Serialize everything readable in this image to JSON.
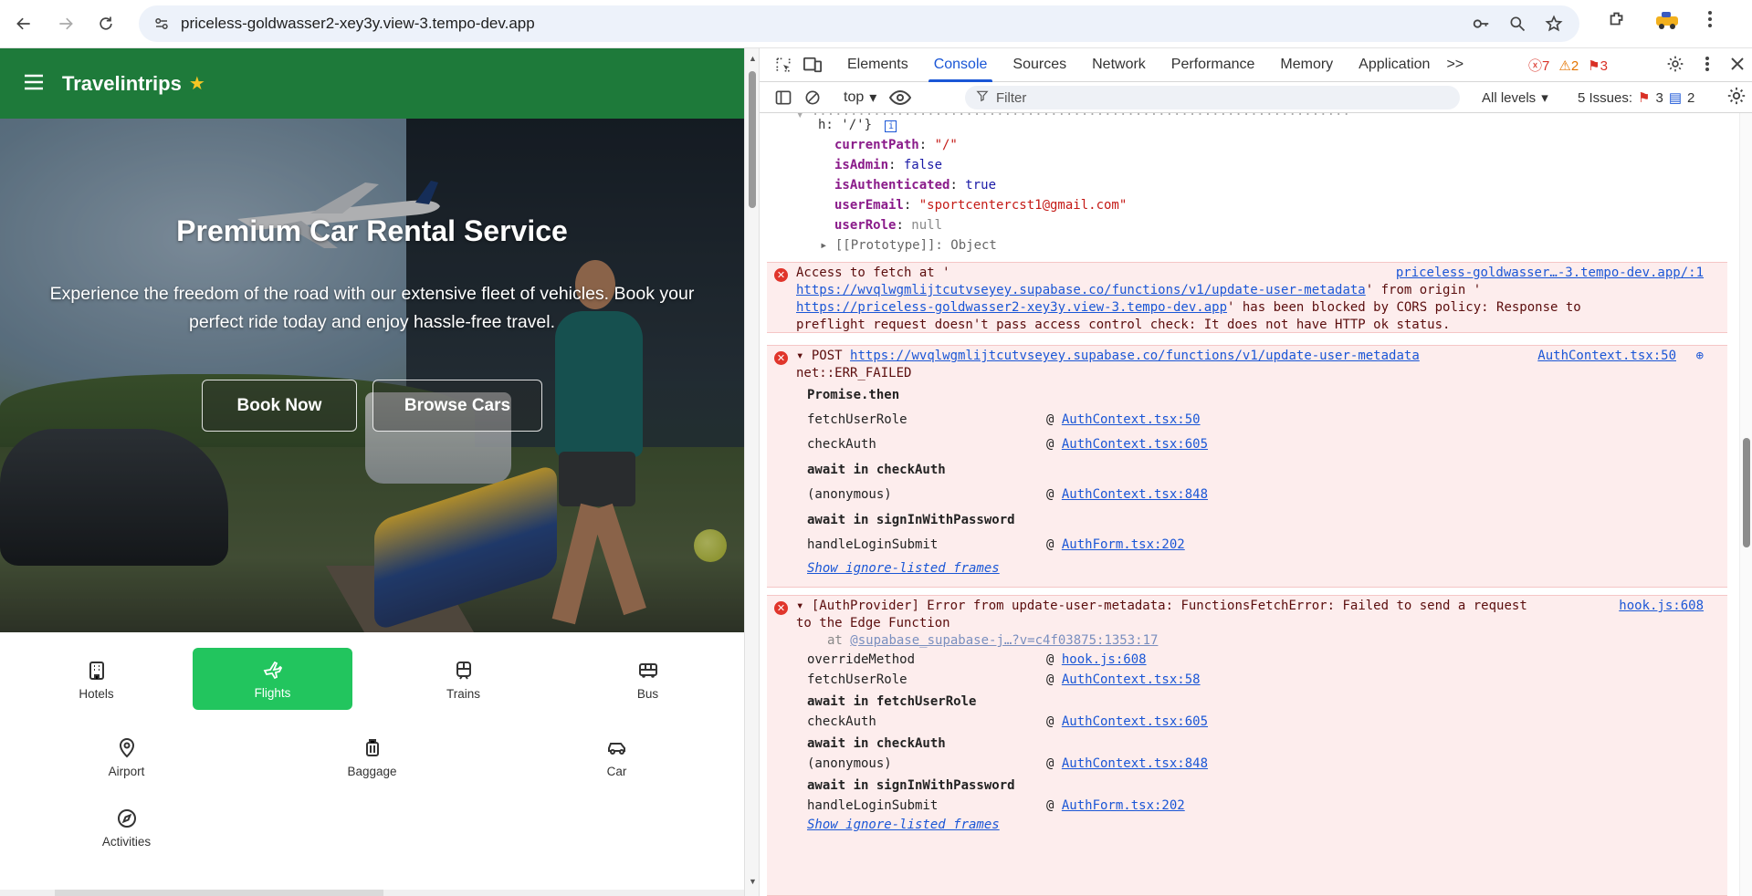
{
  "browser": {
    "url": "priceless-goldwasser2-xey3y.view-3.tempo-dev.app"
  },
  "site": {
    "brand": "Travelintrips",
    "hero_title": "Premium Car Rental Service",
    "hero_subtitle": "Experience the freedom of the road with our extensive fleet of vehicles. Book your perfect ride today and enjoy hassle-free travel.",
    "book_now": "Book Now",
    "browse_cars": "Browse Cars",
    "categories": [
      {
        "label": "Hotels",
        "icon": "hotel-icon",
        "active": false
      },
      {
        "label": "Flights",
        "icon": "plane-icon",
        "active": true
      },
      {
        "label": "Trains",
        "icon": "train-icon",
        "active": false
      },
      {
        "label": "Bus",
        "icon": "bus-icon",
        "active": false
      },
      {
        "label": "Airport",
        "icon": "map-pin-icon",
        "active": false
      },
      {
        "label": "Baggage",
        "icon": "luggage-icon",
        "active": false
      },
      {
        "label": "Car",
        "icon": "car-icon",
        "active": false
      },
      {
        "label": "Activities",
        "icon": "compass-icon",
        "active": false
      }
    ],
    "brand_color": "#1e7a3a",
    "active_color": "#22c55e"
  },
  "devtools": {
    "tabs": [
      "Elements",
      "Console",
      "Sources",
      "Network",
      "Performance",
      "Memory",
      "Application"
    ],
    "active_tab": "Console",
    "more_tabs": ">>",
    "error_count": "7",
    "warning_count": "2",
    "issue_count_badge": "3",
    "context": "top",
    "filter_placeholder": "Filter",
    "levels": "All levels",
    "issues_label": "5 Issues:",
    "issues_red": "3",
    "issues_blue": "2"
  },
  "console": {
    "obj_header_tail": "h: '/'}",
    "obj_props": [
      {
        "key": "currentPath",
        "value": "\"/\"",
        "type": "str"
      },
      {
        "key": "isAdmin",
        "value": "false",
        "type": "kw"
      },
      {
        "key": "isAuthenticated",
        "value": "true",
        "type": "kw"
      },
      {
        "key": "userEmail",
        "value": "\"sportcentercst1@gmail.com\"",
        "type": "str"
      },
      {
        "key": "userRole",
        "value": "null",
        "type": "nul"
      }
    ],
    "prototype": "[[Prototype]]: Object",
    "err1": {
      "line1": "Access to fetch at '",
      "source": "priceless-goldwasser…-3.tempo-dev.app/:1",
      "link1": "https://wvqlwgmlijtcutvseyey.supabase.co/functions/v1/update-user-metadata",
      "mid1": "' from origin '",
      "link2": "https://priceless-goldwasser2-xey3y.view-3.tempo-dev.app",
      "mid2": "' has been blocked by CORS policy: Response to",
      "line4": "preflight request doesn't pass access control check: It does not have HTTP ok status."
    },
    "err2": {
      "method": "POST",
      "url": "https://wvqlwgmlijtcutvseyey.supabase.co/functions/v1/update-user-metadata",
      "source": "AuthContext.tsx:50",
      "status": "net::ERR_FAILED",
      "stack": [
        {
          "kind": "bold",
          "text": "Promise.then"
        },
        {
          "kind": "frame",
          "fn": "fetchUserRole",
          "loc": "AuthContext.tsx:50"
        },
        {
          "kind": "frame",
          "fn": "checkAuth",
          "loc": "AuthContext.tsx:605"
        },
        {
          "kind": "bold",
          "text": "await in checkAuth"
        },
        {
          "kind": "frame",
          "fn": "(anonymous)",
          "loc": "AuthContext.tsx:848"
        },
        {
          "kind": "bold",
          "text": "await in signInWithPassword"
        },
        {
          "kind": "frame",
          "fn": "handleLoginSubmit",
          "loc": "AuthForm.tsx:202"
        }
      ],
      "ignore": "Show ignore-listed frames"
    },
    "err3": {
      "line1": "[AuthProvider] Error from update-user-metadata: FunctionsFetchError: Failed to send a request",
      "line2": "to the Edge Function",
      "source": "hook.js:608",
      "at_prefix": "at ",
      "at_link": "@supabase_supabase-j…?v=c4f03875:1353:17",
      "stack": [
        {
          "kind": "frame",
          "fn": "overrideMethod",
          "loc": "hook.js:608"
        },
        {
          "kind": "frame",
          "fn": "fetchUserRole",
          "loc": "AuthContext.tsx:58"
        },
        {
          "kind": "bold",
          "text": "await in fetchUserRole"
        },
        {
          "kind": "frame",
          "fn": "checkAuth",
          "loc": "AuthContext.tsx:605"
        },
        {
          "kind": "bold",
          "text": "await in checkAuth"
        },
        {
          "kind": "frame",
          "fn": "(anonymous)",
          "loc": "AuthContext.tsx:848"
        },
        {
          "kind": "bold",
          "text": "await in signInWithPassword"
        },
        {
          "kind": "frame",
          "fn": "handleLoginSubmit",
          "loc": "AuthForm.tsx:202"
        }
      ],
      "ignore": "Show ignore-listed frames"
    }
  }
}
